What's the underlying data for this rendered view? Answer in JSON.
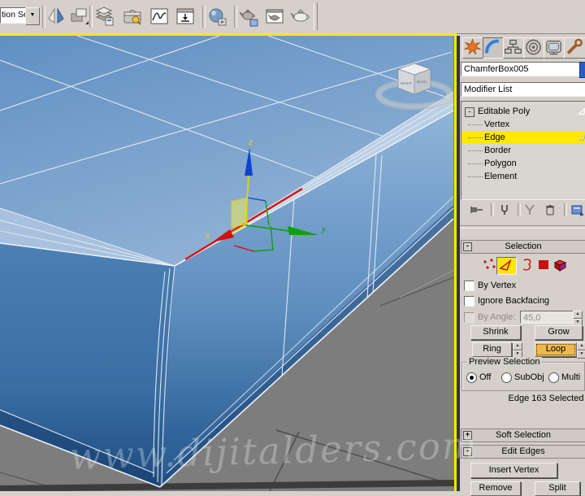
{
  "ui": {
    "dropdown_arrow": "▼",
    "spinner_up": "▲",
    "spinner_down": "▼"
  },
  "toolbar": {
    "selection_sets_value": "tion Se",
    "icons": [
      "mirror-icon",
      "align-icon",
      "layer-manager-icon",
      "scene-explorer-icon",
      "curve-editor-icon",
      "schematic-view-icon",
      "material-editor-icon",
      "render-setup-icon",
      "rendered-frame-window-icon",
      "render-production-icon"
    ]
  },
  "viewport": {
    "watermark": "www.dijitalders.com",
    "viewcube": {
      "left_face": "RIGHT",
      "right_face": "BACK"
    },
    "gizmo": {
      "x": "x",
      "y": "y",
      "z": "z"
    },
    "colors": {
      "viewport_border": "#ffe800",
      "object_blue": "#4a7db3",
      "selected_edge": "#e01010",
      "axis_x": "#d01010",
      "axis_y": "#10a010",
      "axis_z": "#1040d0",
      "gizmo_highlight": "#e8d400",
      "ground": "#7d7d7d"
    }
  },
  "panel": {
    "tabs": [
      {
        "name": "create"
      },
      {
        "name": "modify",
        "active": true
      },
      {
        "name": "hierarchy"
      },
      {
        "name": "motion"
      },
      {
        "name": "display"
      },
      {
        "name": "utilities"
      }
    ],
    "object_name": "ChamferBox005",
    "modifier_list_value": "Modifier List",
    "stack": {
      "expand_marker": "-",
      "items": [
        {
          "label": "Editable Poly"
        },
        {
          "label": "Vertex"
        },
        {
          "label": "Edge"
        },
        {
          "label": "Border"
        },
        {
          "label": "Polygon"
        },
        {
          "label": "Element"
        }
      ]
    },
    "stack_tools": [
      "pin-stack",
      "show-end-result",
      "make-unique",
      "remove-modifier",
      "configure-modifier-sets"
    ],
    "selection": {
      "marker": "-",
      "title": "Selection",
      "by_vertex": "By Vertex",
      "ignore_backfacing": "Ignore Backfacing",
      "by_angle": "By Angle:",
      "by_angle_value": "45,0",
      "shrink": "Shrink",
      "grow": "Grow",
      "ring": "Ring",
      "loop": "Loop",
      "preview_title": "Preview Selection",
      "opt_off": "Off",
      "opt_subobj": "SubObj",
      "opt_multi": "Multi",
      "status": "Edge 163 Selected"
    },
    "soft_selection": {
      "marker": "+",
      "title": "Soft Selection"
    },
    "edit_edges": {
      "marker": "-",
      "title": "Edit Edges",
      "insert_vertex": "Insert Vertex",
      "remove": "Remove",
      "split": "Split"
    },
    "colors": {
      "selection_highlight": "#ffe800",
      "loop_active": "#ecb850",
      "object_swatch": "#2a5cc8"
    }
  }
}
